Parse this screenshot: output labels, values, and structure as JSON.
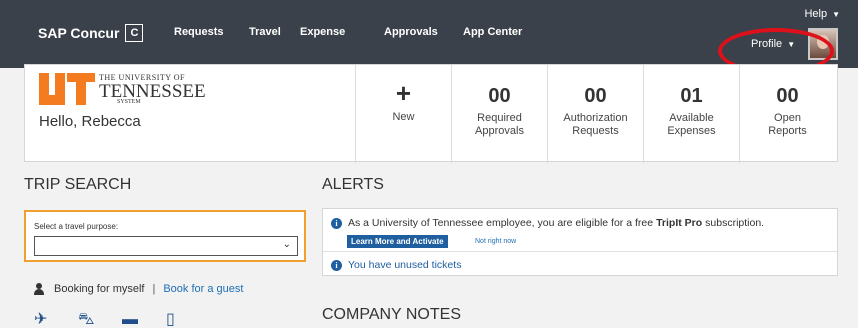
{
  "nav": {
    "brand": "SAP Concur",
    "brand_mark": "C",
    "items": [
      "Requests",
      "Travel",
      "Expense",
      "Approvals",
      "App Center"
    ],
    "help": "Help",
    "profile": "Profile"
  },
  "header": {
    "logo_line1": "THE UNIVERSITY OF",
    "logo_line2": "TENNESSEE",
    "logo_line3": "SYSTEM",
    "greeting": "Hello, Rebecca",
    "new_label": "New",
    "new_symbol": "+",
    "stats": [
      {
        "value": "00",
        "label1": "Required",
        "label2": "Approvals"
      },
      {
        "value": "00",
        "label1": "Authorization",
        "label2": "Requests"
      },
      {
        "value": "01",
        "label1": "Available",
        "label2": "Expenses"
      },
      {
        "value": "00",
        "label1": "Open",
        "label2": "Reports"
      }
    ]
  },
  "trip_search": {
    "title": "TRIP SEARCH",
    "purpose_label": "Select a travel purpose:",
    "purpose_value": "",
    "booking_self": "Booking for myself",
    "separator": "|",
    "booking_guest": "Book for a guest"
  },
  "alerts": {
    "title": "ALERTS",
    "alert1_pre": "As a University of Tennessee employee, you are eligible for a free",
    "alert1_bold": "TripIt Pro",
    "alert1_post": "subscription.",
    "learn_more": "Learn More and Activate",
    "not_now": "Not right now",
    "alert2": "You have unused tickets"
  },
  "company_notes": {
    "title": "COMPANY NOTES"
  },
  "colors": {
    "topbar": "#3b414a",
    "accent_blue": "#1f5f9f",
    "highlight_orange": "#f0a030",
    "annotation_red": "#e0101a",
    "logo_orange": "#f47b20"
  }
}
